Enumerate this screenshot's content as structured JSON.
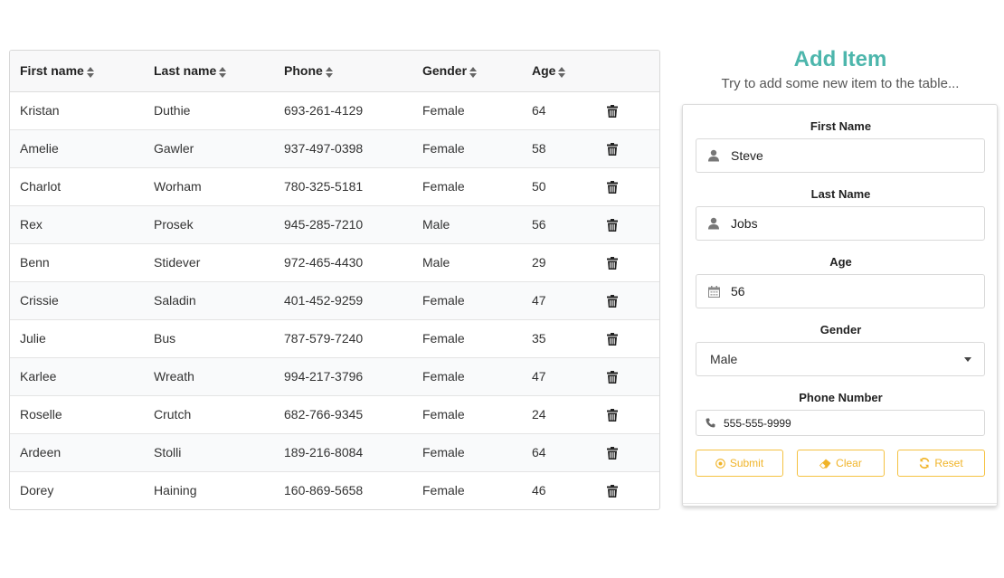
{
  "table": {
    "headers": [
      "First name",
      "Last name",
      "Phone",
      "Gender",
      "Age"
    ],
    "rows": [
      {
        "first": "Kristan",
        "last": "Duthie",
        "phone": "693-261-4129",
        "gender": "Female",
        "age": "64"
      },
      {
        "first": "Amelie",
        "last": "Gawler",
        "phone": "937-497-0398",
        "gender": "Female",
        "age": "58"
      },
      {
        "first": "Charlot",
        "last": "Worham",
        "phone": "780-325-5181",
        "gender": "Female",
        "age": "50"
      },
      {
        "first": "Rex",
        "last": "Prosek",
        "phone": "945-285-7210",
        "gender": "Male",
        "age": "56"
      },
      {
        "first": "Benn",
        "last": "Stidever",
        "phone": "972-465-4430",
        "gender": "Male",
        "age": "29"
      },
      {
        "first": "Crissie",
        "last": "Saladin",
        "phone": "401-452-9259",
        "gender": "Female",
        "age": "47"
      },
      {
        "first": "Julie",
        "last": "Bus",
        "phone": "787-579-7240",
        "gender": "Female",
        "age": "35"
      },
      {
        "first": "Karlee",
        "last": "Wreath",
        "phone": "994-217-3796",
        "gender": "Female",
        "age": "47"
      },
      {
        "first": "Roselle",
        "last": "Crutch",
        "phone": "682-766-9345",
        "gender": "Female",
        "age": "24"
      },
      {
        "first": "Ardeen",
        "last": "Stolli",
        "phone": "189-216-8084",
        "gender": "Female",
        "age": "64"
      },
      {
        "first": "Dorey",
        "last": "Haining",
        "phone": "160-869-5658",
        "gender": "Female",
        "age": "46"
      }
    ],
    "row_action_icon": "trash-icon"
  },
  "form": {
    "title": "Add Item",
    "subtitle": "Try to add some new item to the table...",
    "first_name": {
      "label": "First Name",
      "value": "Steve",
      "icon": "user-icon"
    },
    "last_name": {
      "label": "Last Name",
      "value": "Jobs",
      "icon": "user-icon"
    },
    "age": {
      "label": "Age",
      "value": "56",
      "icon": "calendar-icon"
    },
    "gender": {
      "label": "Gender",
      "value": "Male"
    },
    "phone": {
      "label": "Phone Number",
      "value": "555-555-9999",
      "icon": "phone-icon"
    },
    "buttons": {
      "submit": "Submit",
      "clear": "Clear",
      "reset": "Reset"
    }
  },
  "colors": {
    "title_accent": "#4db6ac",
    "button_accent": "#f0b429"
  }
}
